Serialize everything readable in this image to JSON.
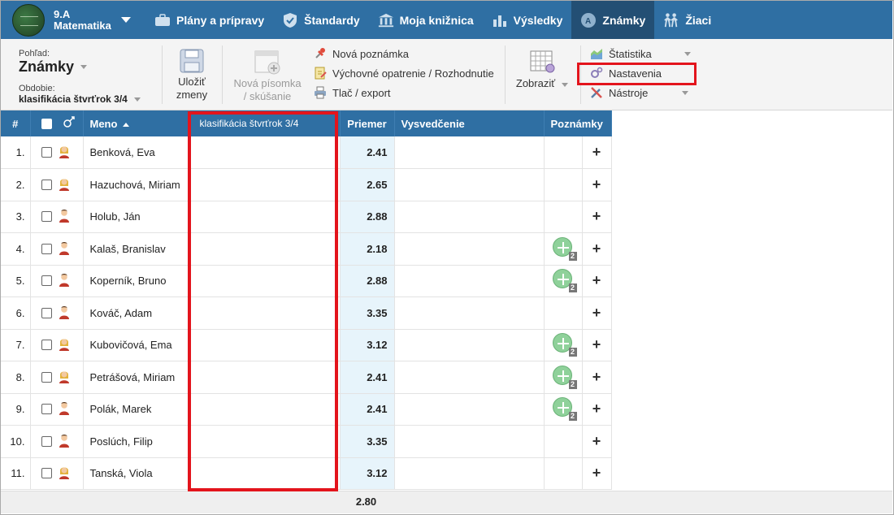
{
  "topnav": {
    "class_name": "9.A",
    "subject": "Matematika",
    "items": [
      {
        "label": "Plány a prípravy",
        "icon": "briefcase-icon"
      },
      {
        "label": "Štandardy",
        "icon": "shield-icon"
      },
      {
        "label": "Moja knižnica",
        "icon": "library-icon"
      },
      {
        "label": "Výsledky",
        "icon": "bar-chart-icon"
      },
      {
        "label": "Známky",
        "icon": "grade-icon"
      },
      {
        "label": "Žiaci",
        "icon": "students-icon"
      }
    ],
    "active": "Známky"
  },
  "toolbar": {
    "view_label": "Pohľad:",
    "view_value": "Známky",
    "period_label": "Obdobie:",
    "period_value": "klasifikácia štvrťrok 3/4",
    "save_line1": "Uložiť",
    "save_line2": "zmeny",
    "new_test_line1": "Nová písomka",
    "new_test_line2": "/ skúšanie",
    "new_note": "Nová poznámka",
    "edu_measure": "Výchovné opatrenie / Rozhodnutie",
    "print_export": "Tlač / export",
    "show": "Zobraziť",
    "statistics": "Štatistika",
    "settings": "Nastavenia",
    "tools": "Nástroje"
  },
  "table": {
    "headers": {
      "num": "#",
      "name": "Meno",
      "period": "klasifikácia štvrťrok 3/4",
      "avg": "Priemer",
      "report": "Vysvedčenie",
      "notes": "Poznámky"
    },
    "rows": [
      {
        "n": "1.",
        "name": "Benková, Eva",
        "avg": "2.41",
        "gender": "female",
        "notes": ""
      },
      {
        "n": "2.",
        "name": "Hazuchová, Miriam",
        "avg": "2.65",
        "gender": "female",
        "notes": ""
      },
      {
        "n": "3.",
        "name": "Holub, Ján",
        "avg": "2.88",
        "gender": "male",
        "notes": ""
      },
      {
        "n": "4.",
        "name": "Kalaš, Branislav",
        "avg": "2.18",
        "gender": "male",
        "notes": "2"
      },
      {
        "n": "5.",
        "name": "Koperník, Bruno",
        "avg": "2.88",
        "gender": "male",
        "notes": "2"
      },
      {
        "n": "6.",
        "name": "Kováč, Adam",
        "avg": "3.35",
        "gender": "male",
        "notes": ""
      },
      {
        "n": "7.",
        "name": "Kubovičová, Ema",
        "avg": "3.12",
        "gender": "female",
        "notes": "2"
      },
      {
        "n": "8.",
        "name": "Petrášová, Miriam",
        "avg": "2.41",
        "gender": "female",
        "notes": "2"
      },
      {
        "n": "9.",
        "name": "Polák, Marek",
        "avg": "2.41",
        "gender": "male",
        "notes": "2"
      },
      {
        "n": "10.",
        "name": "Poslúch, Filip",
        "avg": "3.35",
        "gender": "male",
        "notes": ""
      },
      {
        "n": "11.",
        "name": "Tanská, Viola",
        "avg": "3.12",
        "gender": "female",
        "notes": ""
      }
    ],
    "add_symbol": "+",
    "class_average": "2.80"
  },
  "colors": {
    "nav_bg": "#2f6fa3",
    "nav_active": "#234f74",
    "avg_bg": "#e7f4fb",
    "highlight": "#e3141c"
  }
}
